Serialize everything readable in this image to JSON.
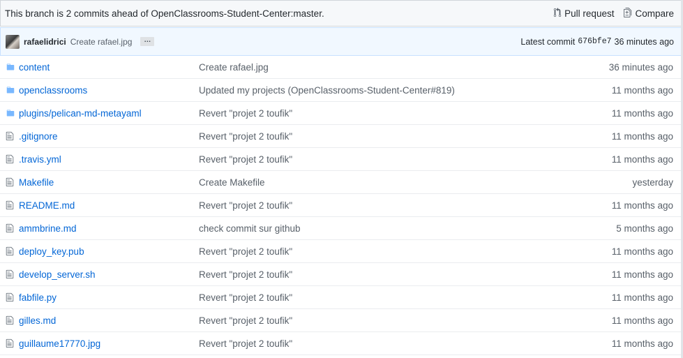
{
  "branch_bar": {
    "text": "This branch is 2 commits ahead of OpenClassrooms-Student-Center:master.",
    "pull_request_label": "Pull request",
    "compare_label": "Compare"
  },
  "latest_commit": {
    "author": "rafaelidrici",
    "message": "Create rafael.jpg",
    "ellipsis": "…",
    "prefix": "Latest commit",
    "sha": "676bfe7",
    "age": "36 minutes ago"
  },
  "files": [
    {
      "type": "folder",
      "name": "content",
      "message": "Create rafael.jpg",
      "age": "36 minutes ago"
    },
    {
      "type": "folder",
      "name": "openclassrooms",
      "message": "Updated my projects (OpenClassrooms-Student-Center#819)",
      "age": "11 months ago"
    },
    {
      "type": "folder",
      "name": "plugins/pelican-md-metayaml",
      "message": "Revert \"projet 2 toufik\"",
      "age": "11 months ago"
    },
    {
      "type": "file",
      "name": ".gitignore",
      "message": "Revert \"projet 2 toufik\"",
      "age": "11 months ago"
    },
    {
      "type": "file",
      "name": ".travis.yml",
      "message": "Revert \"projet 2 toufik\"",
      "age": "11 months ago"
    },
    {
      "type": "file",
      "name": "Makefile",
      "message": "Create Makefile",
      "age": "yesterday"
    },
    {
      "type": "file",
      "name": "README.md",
      "message": "Revert \"projet 2 toufik\"",
      "age": "11 months ago"
    },
    {
      "type": "file",
      "name": "ammbrine.md",
      "message": "check commit sur github",
      "age": "5 months ago"
    },
    {
      "type": "file",
      "name": "deploy_key.pub",
      "message": "Revert \"projet 2 toufik\"",
      "age": "11 months ago"
    },
    {
      "type": "file",
      "name": "develop_server.sh",
      "message": "Revert \"projet 2 toufik\"",
      "age": "11 months ago"
    },
    {
      "type": "file",
      "name": "fabfile.py",
      "message": "Revert \"projet 2 toufik\"",
      "age": "11 months ago"
    },
    {
      "type": "file",
      "name": "gilles.md",
      "message": "Revert \"projet 2 toufik\"",
      "age": "11 months ago"
    },
    {
      "type": "file",
      "name": "guillaume17770.jpg",
      "message": "Revert \"projet 2 toufik\"",
      "age": "11 months ago"
    }
  ],
  "colors": {
    "link": "#0366d6",
    "folder_icon": "#79b8ff",
    "file_icon": "#6a737d",
    "muted": "#586069"
  }
}
